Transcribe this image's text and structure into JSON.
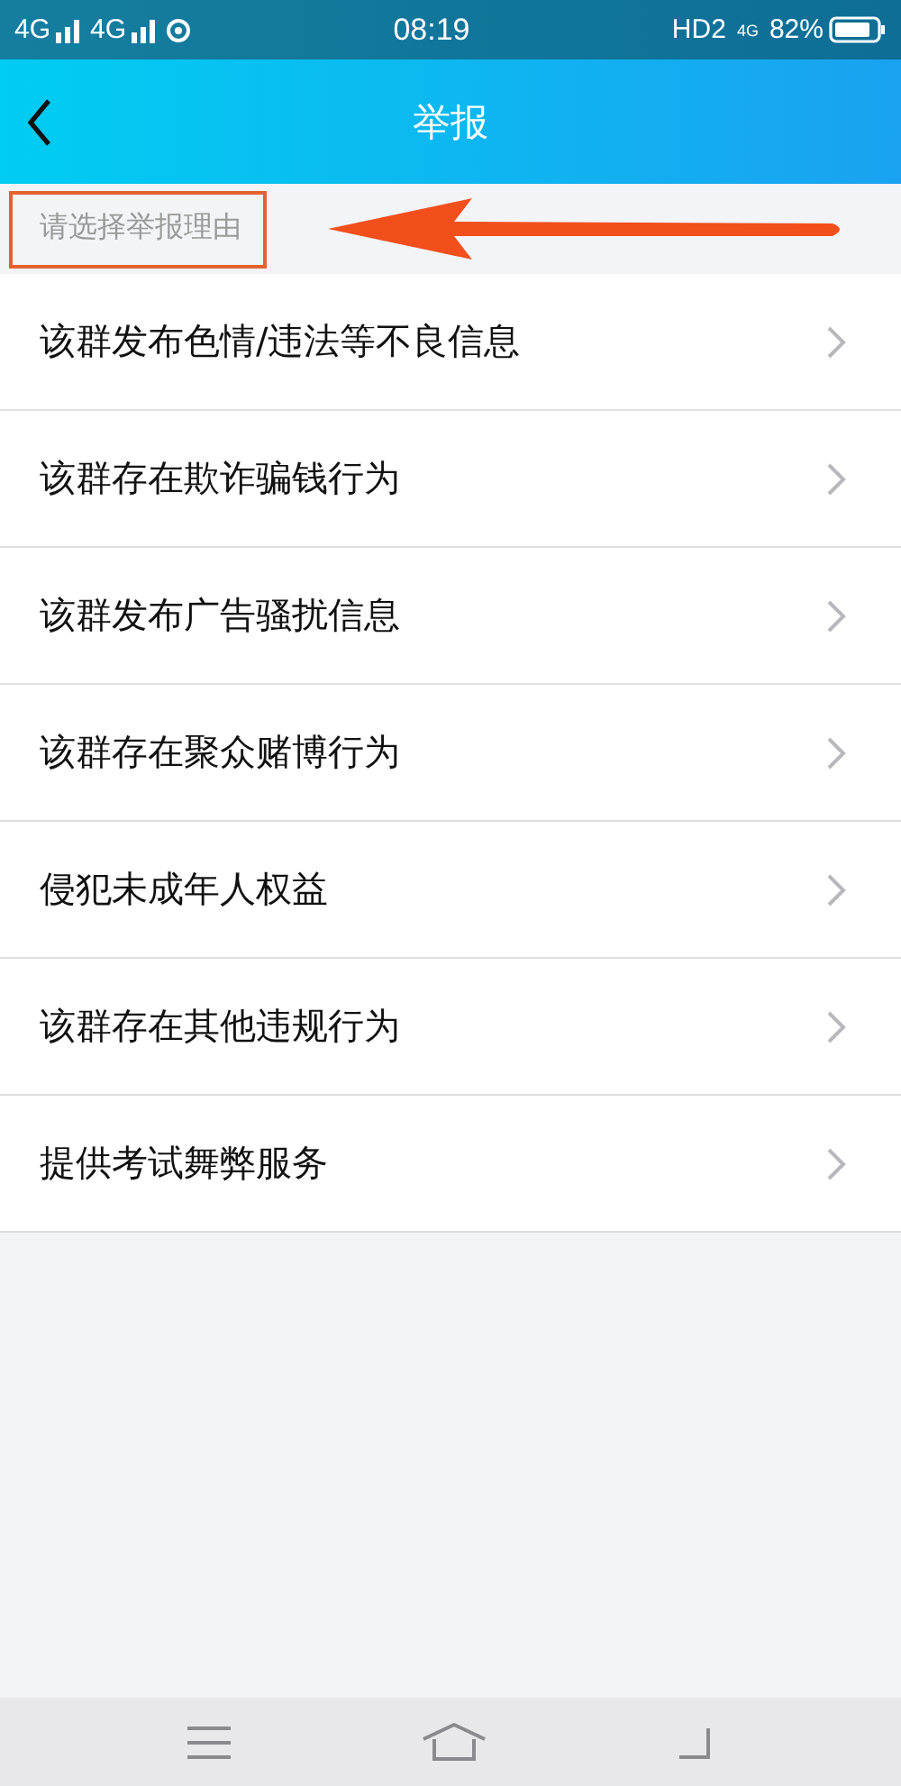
{
  "status_bar": {
    "left": [
      "4G",
      "4G"
    ],
    "time": "08:19",
    "right": {
      "hd": "HD2",
      "net": "4G",
      "battery": "82%"
    }
  },
  "header": {
    "title": "举报"
  },
  "section": {
    "label": "请选择举报理由"
  },
  "reasons": [
    {
      "label": "该群发布色情/违法等不良信息"
    },
    {
      "label": "该群存在欺诈骗钱行为"
    },
    {
      "label": "该群发布广告骚扰信息"
    },
    {
      "label": "该群存在聚众赌博行为"
    },
    {
      "label": "侵犯未成年人权益"
    },
    {
      "label": "该群存在其他违规行为"
    },
    {
      "label": "提供考试舞弊服务"
    }
  ]
}
